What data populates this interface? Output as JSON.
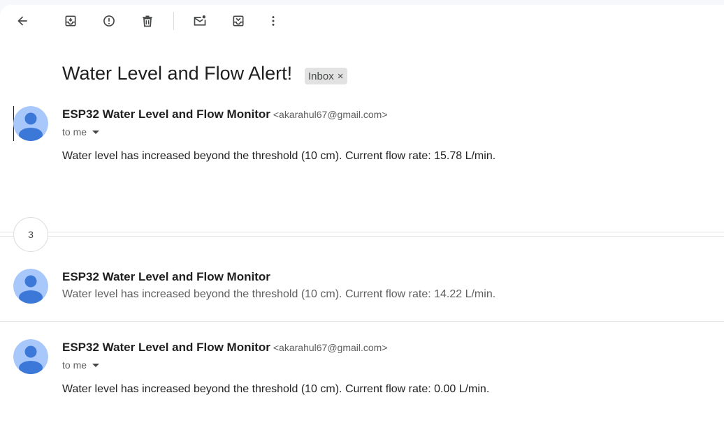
{
  "toolbar": {
    "icons": [
      "back-arrow-icon",
      "archive-icon",
      "report-spam-icon",
      "delete-icon",
      "mark-unread-icon",
      "move-to-icon",
      "more-vert-icon"
    ]
  },
  "thread": {
    "subject": "Water Level and Flow Alert!",
    "label": "Inbox",
    "label_close": "×",
    "collapsed_count": "3"
  },
  "messages": [
    {
      "sender": "ESP32 Water Level and Flow Monitor",
      "email": "<akarahul67@gmail.com>",
      "to": "to me",
      "body": "Water level has increased beyond the threshold (10 cm). Current flow rate: 15.78 L/min."
    },
    {
      "sender": "ESP32 Water Level and Flow Monitor",
      "snippet": "Water level has increased beyond the threshold (10 cm). Current flow rate: 14.22 L/min."
    },
    {
      "sender": "ESP32 Water Level and Flow Monitor",
      "email": "<akarahul67@gmail.com>",
      "to": "to me",
      "body": "Water level has increased beyond the threshold (10 cm). Current flow rate: 0.00 L/min."
    }
  ],
  "colors": {
    "avatar_bg": "#a8c7fa",
    "avatar_fg": "#3c78d8"
  }
}
